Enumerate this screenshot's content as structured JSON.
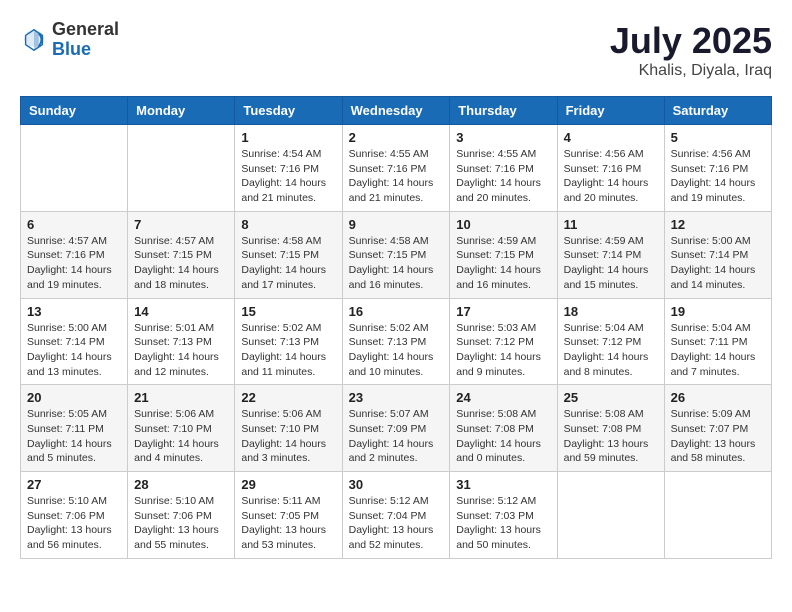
{
  "logo": {
    "general": "General",
    "blue": "Blue"
  },
  "title": {
    "month": "July 2025",
    "location": "Khalis, Diyala, Iraq"
  },
  "header": {
    "days": [
      "Sunday",
      "Monday",
      "Tuesday",
      "Wednesday",
      "Thursday",
      "Friday",
      "Saturday"
    ]
  },
  "weeks": [
    {
      "cells": [
        {
          "day": "",
          "content": ""
        },
        {
          "day": "",
          "content": ""
        },
        {
          "day": "1",
          "content": "Sunrise: 4:54 AM\nSunset: 7:16 PM\nDaylight: 14 hours and 21 minutes."
        },
        {
          "day": "2",
          "content": "Sunrise: 4:55 AM\nSunset: 7:16 PM\nDaylight: 14 hours and 21 minutes."
        },
        {
          "day": "3",
          "content": "Sunrise: 4:55 AM\nSunset: 7:16 PM\nDaylight: 14 hours and 20 minutes."
        },
        {
          "day": "4",
          "content": "Sunrise: 4:56 AM\nSunset: 7:16 PM\nDaylight: 14 hours and 20 minutes."
        },
        {
          "day": "5",
          "content": "Sunrise: 4:56 AM\nSunset: 7:16 PM\nDaylight: 14 hours and 19 minutes."
        }
      ]
    },
    {
      "cells": [
        {
          "day": "6",
          "content": "Sunrise: 4:57 AM\nSunset: 7:16 PM\nDaylight: 14 hours and 19 minutes."
        },
        {
          "day": "7",
          "content": "Sunrise: 4:57 AM\nSunset: 7:15 PM\nDaylight: 14 hours and 18 minutes."
        },
        {
          "day": "8",
          "content": "Sunrise: 4:58 AM\nSunset: 7:15 PM\nDaylight: 14 hours and 17 minutes."
        },
        {
          "day": "9",
          "content": "Sunrise: 4:58 AM\nSunset: 7:15 PM\nDaylight: 14 hours and 16 minutes."
        },
        {
          "day": "10",
          "content": "Sunrise: 4:59 AM\nSunset: 7:15 PM\nDaylight: 14 hours and 16 minutes."
        },
        {
          "day": "11",
          "content": "Sunrise: 4:59 AM\nSunset: 7:14 PM\nDaylight: 14 hours and 15 minutes."
        },
        {
          "day": "12",
          "content": "Sunrise: 5:00 AM\nSunset: 7:14 PM\nDaylight: 14 hours and 14 minutes."
        }
      ]
    },
    {
      "cells": [
        {
          "day": "13",
          "content": "Sunrise: 5:00 AM\nSunset: 7:14 PM\nDaylight: 14 hours and 13 minutes."
        },
        {
          "day": "14",
          "content": "Sunrise: 5:01 AM\nSunset: 7:13 PM\nDaylight: 14 hours and 12 minutes."
        },
        {
          "day": "15",
          "content": "Sunrise: 5:02 AM\nSunset: 7:13 PM\nDaylight: 14 hours and 11 minutes."
        },
        {
          "day": "16",
          "content": "Sunrise: 5:02 AM\nSunset: 7:13 PM\nDaylight: 14 hours and 10 minutes."
        },
        {
          "day": "17",
          "content": "Sunrise: 5:03 AM\nSunset: 7:12 PM\nDaylight: 14 hours and 9 minutes."
        },
        {
          "day": "18",
          "content": "Sunrise: 5:04 AM\nSunset: 7:12 PM\nDaylight: 14 hours and 8 minutes."
        },
        {
          "day": "19",
          "content": "Sunrise: 5:04 AM\nSunset: 7:11 PM\nDaylight: 14 hours and 7 minutes."
        }
      ]
    },
    {
      "cells": [
        {
          "day": "20",
          "content": "Sunrise: 5:05 AM\nSunset: 7:11 PM\nDaylight: 14 hours and 5 minutes."
        },
        {
          "day": "21",
          "content": "Sunrise: 5:06 AM\nSunset: 7:10 PM\nDaylight: 14 hours and 4 minutes."
        },
        {
          "day": "22",
          "content": "Sunrise: 5:06 AM\nSunset: 7:10 PM\nDaylight: 14 hours and 3 minutes."
        },
        {
          "day": "23",
          "content": "Sunrise: 5:07 AM\nSunset: 7:09 PM\nDaylight: 14 hours and 2 minutes."
        },
        {
          "day": "24",
          "content": "Sunrise: 5:08 AM\nSunset: 7:08 PM\nDaylight: 14 hours and 0 minutes."
        },
        {
          "day": "25",
          "content": "Sunrise: 5:08 AM\nSunset: 7:08 PM\nDaylight: 13 hours and 59 minutes."
        },
        {
          "day": "26",
          "content": "Sunrise: 5:09 AM\nSunset: 7:07 PM\nDaylight: 13 hours and 58 minutes."
        }
      ]
    },
    {
      "cells": [
        {
          "day": "27",
          "content": "Sunrise: 5:10 AM\nSunset: 7:06 PM\nDaylight: 13 hours and 56 minutes."
        },
        {
          "day": "28",
          "content": "Sunrise: 5:10 AM\nSunset: 7:06 PM\nDaylight: 13 hours and 55 minutes."
        },
        {
          "day": "29",
          "content": "Sunrise: 5:11 AM\nSunset: 7:05 PM\nDaylight: 13 hours and 53 minutes."
        },
        {
          "day": "30",
          "content": "Sunrise: 5:12 AM\nSunset: 7:04 PM\nDaylight: 13 hours and 52 minutes."
        },
        {
          "day": "31",
          "content": "Sunrise: 5:12 AM\nSunset: 7:03 PM\nDaylight: 13 hours and 50 minutes."
        },
        {
          "day": "",
          "content": ""
        },
        {
          "day": "",
          "content": ""
        }
      ]
    }
  ]
}
